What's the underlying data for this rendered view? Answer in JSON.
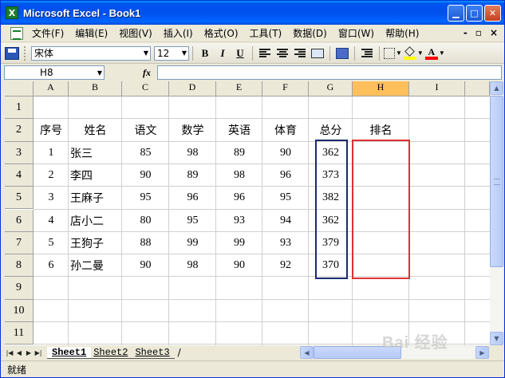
{
  "window": {
    "title": "Microsoft Excel - Book1",
    "app_icon": "excel-icon",
    "controls": [
      "minimize",
      "maximize",
      "close"
    ]
  },
  "menu": {
    "items": [
      "文件(F)",
      "编辑(E)",
      "视图(V)",
      "插入(I)",
      "格式(O)",
      "工具(T)",
      "数据(D)",
      "窗口(W)",
      "帮助(H)"
    ],
    "right_controls": [
      "-",
      "×"
    ]
  },
  "toolbar": {
    "font_name": "宋体",
    "font_size": "12",
    "bold_label": "B",
    "italic_label": "I",
    "underline_label": "U",
    "font_color_label": "A",
    "fill_color": "#ffff00",
    "font_color": "#ff0000"
  },
  "formula_bar": {
    "name_box": "H8",
    "fx_label": "fx",
    "value": ""
  },
  "sheet": {
    "columns": [
      "A",
      "B",
      "C",
      "D",
      "E",
      "F",
      "G",
      "H",
      "I"
    ],
    "active_column": "H",
    "rows": [
      "1",
      "2",
      "3",
      "4",
      "5",
      "6",
      "7",
      "8",
      "9",
      "10",
      "11"
    ],
    "headers": [
      "序号",
      "姓名",
      "语文",
      "数学",
      "英语",
      "体育",
      "总分",
      "排名"
    ],
    "data": [
      [
        "1",
        "张三",
        "85",
        "98",
        "89",
        "90",
        "362"
      ],
      [
        "2",
        "李四",
        "90",
        "89",
        "98",
        "96",
        "373"
      ],
      [
        "3",
        "王麻子",
        "95",
        "96",
        "96",
        "95",
        "382"
      ],
      [
        "4",
        "店小二",
        "80",
        "95",
        "93",
        "94",
        "362"
      ],
      [
        "5",
        "王狗子",
        "88",
        "99",
        "99",
        "93",
        "379"
      ],
      [
        "6",
        "孙二曼",
        "90",
        "98",
        "90",
        "92",
        "370"
      ]
    ],
    "total_box_color": "#1c2a6e",
    "rank_box_color": "#e03030"
  },
  "tabs": {
    "items": [
      "Sheet1",
      "Sheet2",
      "Sheet3"
    ],
    "active": "Sheet1"
  },
  "status": {
    "text": "就绪"
  },
  "watermark": {
    "text": "Bai 经验"
  }
}
